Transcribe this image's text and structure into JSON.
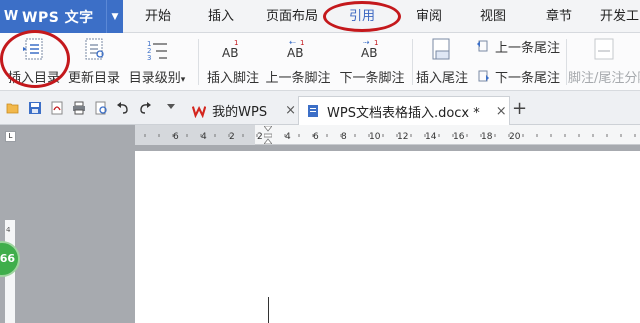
{
  "app": {
    "logo_mark": "W",
    "title": "WPS 文字",
    "dropdown_icon": "caret-down-icon"
  },
  "menu": {
    "tabs": [
      {
        "label": "开始"
      },
      {
        "label": "插入"
      },
      {
        "label": "页面布局"
      },
      {
        "label": "引用",
        "active": true
      },
      {
        "label": "审阅"
      },
      {
        "label": "视图"
      },
      {
        "label": "章节"
      },
      {
        "label": "开发工"
      }
    ]
  },
  "ribbon": {
    "insert_toc": "插入目录",
    "update_toc": "更新目录",
    "toc_level": "目录级别",
    "toc_level_caret": "▾",
    "insert_footnote": "插入脚注",
    "prev_footnote": "上一条脚注",
    "next_footnote": "下一条脚注",
    "insert_endnote": "插入尾注",
    "prev_endnote": "上一条尾注",
    "next_endnote": "下一条尾注",
    "footnote_endnote_separator": "脚注/尾注分隔",
    "icon_text": {
      "ab": "AB",
      "sup_1": "1",
      "toc_nums": [
        "1",
        "2",
        "3"
      ]
    }
  },
  "doc_tabs": {
    "tabs": [
      {
        "label": "我的WPS",
        "close": "×"
      },
      {
        "label": "WPS文档表格插入.docx *",
        "close": "×"
      }
    ],
    "new_tab": "+"
  },
  "ruler": {
    "marks": [
      "6",
      "4",
      "2",
      "2",
      "4",
      "6",
      "8",
      "10",
      "12",
      "14",
      "16",
      "18",
      "20"
    ]
  },
  "side": {
    "badge": "66",
    "vruler_mark": "4"
  },
  "colors": {
    "accent": "#3c6fc7",
    "highlight_ring": "#c4181c",
    "active_tab": "#3b66c1",
    "badge": "#3fae4b"
  }
}
